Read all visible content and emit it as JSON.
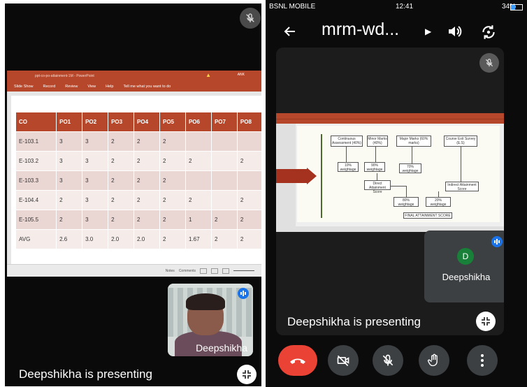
{
  "left_panel": {
    "presenting_text": "Deepshikha is presenting",
    "ppt": {
      "title": "ppt-co-po-attainment-1M - PowerPoint",
      "user_badge": "ANK",
      "ribbon_tabs": [
        "Slide Show",
        "Record",
        "Review",
        "View",
        "Help",
        "Tell me what you want to do"
      ],
      "status_notes": "Notes",
      "status_comments": "Comments"
    },
    "table": {
      "headers": [
        "CO",
        "PO1",
        "PO2",
        "PO3",
        "PO4",
        "PO5",
        "PO6",
        "PO7",
        "PO8"
      ],
      "rows": [
        [
          "E-103.1",
          "3",
          "3",
          "2",
          "2",
          "2",
          "",
          "",
          ""
        ],
        [
          "E-103.2",
          "3",
          "3",
          "2",
          "2",
          "2",
          "2",
          "",
          "2"
        ],
        [
          "E-103.3",
          "3",
          "3",
          "2",
          "2",
          "2",
          "",
          "",
          ""
        ],
        [
          "E-104.4",
          "2",
          "3",
          "2",
          "2",
          "2",
          "2",
          "",
          "2"
        ],
        [
          "E-105.5",
          "2",
          "3",
          "2",
          "2",
          "2",
          "1",
          "2",
          "2"
        ],
        [
          "AVG",
          "2.6",
          "3.0",
          "2.0",
          "2.0",
          "2",
          "1.67",
          "2",
          "2"
        ]
      ]
    },
    "self_view_name": "Deepshikha"
  },
  "right_panel": {
    "status_bar": {
      "carrier": "BSNL MOBILE",
      "time": "12:41",
      "battery": "34%"
    },
    "meeting_title": "mrm-wd...",
    "presenting_text": "Deepshikha is presenting",
    "participant": {
      "initial": "D",
      "name": "Deepshikha"
    },
    "slide_boxes": {
      "continuous": "Continuous Assessment (40%)",
      "minor": "Minor Marks (40%)",
      "major": "Major Marks (60% marks)",
      "survey": "Course Exit Survey (E.S)",
      "w1": "10% weightage",
      "w2": "90% weightage",
      "w3": "70% weightage",
      "direct": "Direct Attainment Score",
      "indirect": "Indirect Attainment Score",
      "w4": "80% weightage",
      "w5": "20% weightage",
      "final": "FINAL ATTAINMENT SCORE"
    }
  },
  "colors": {
    "ppt_accent": "#b7472a",
    "end_call": "#ea4335",
    "speaking_blue": "#1a73e8",
    "avatar_green": "#188038"
  },
  "icons": [
    "mic-off-icon",
    "back-arrow-icon",
    "speaker-icon",
    "flip-camera-icon",
    "pin-icon",
    "end-call-icon",
    "camera-off-icon",
    "raise-hand-icon",
    "more-vert-icon",
    "speaking-icon",
    "wifi-icon",
    "battery-icon"
  ]
}
